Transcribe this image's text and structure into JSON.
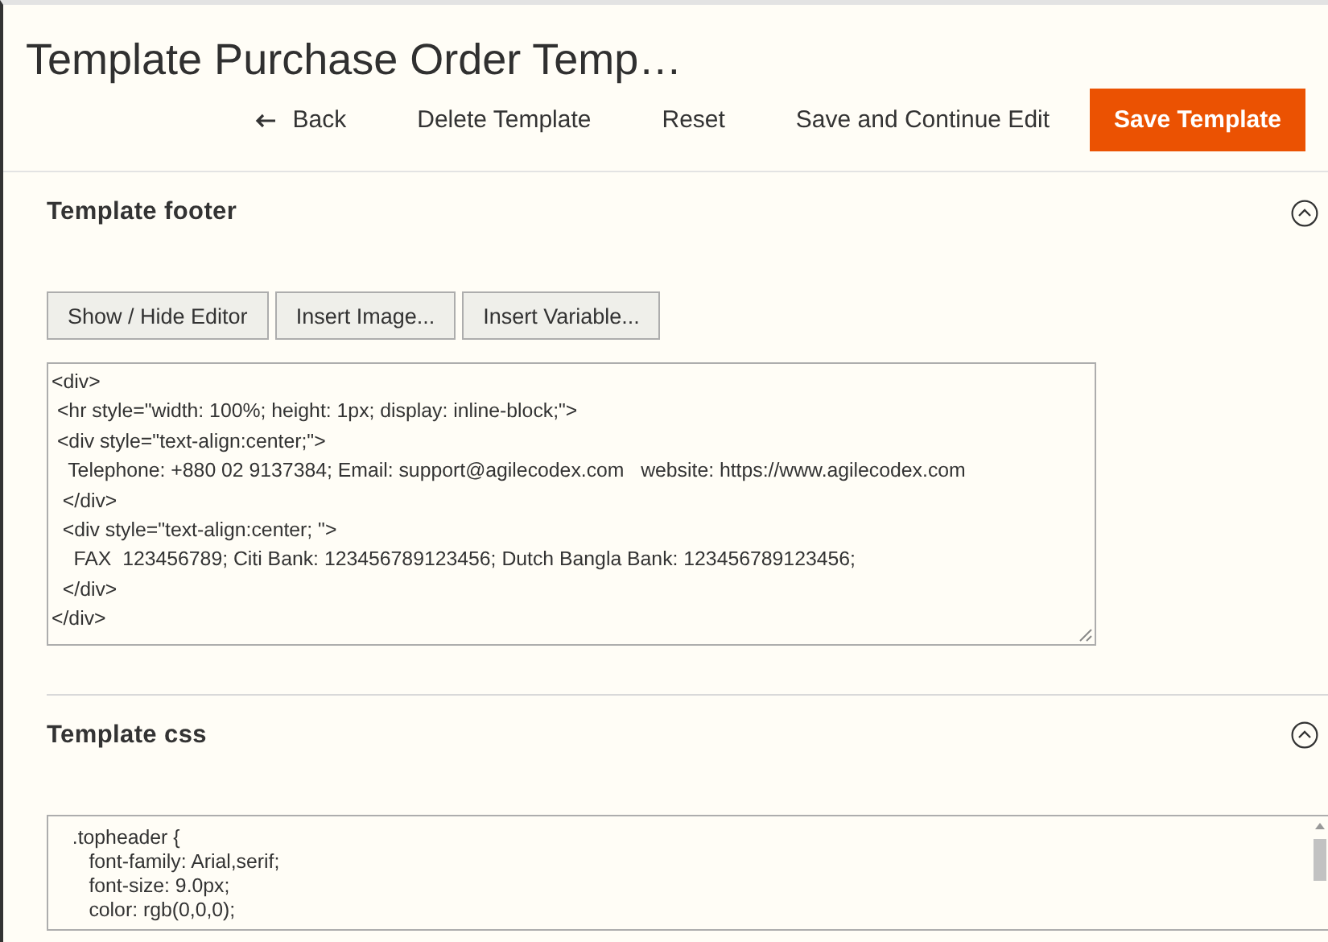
{
  "page": {
    "title": "Template Purchase Order Temp…"
  },
  "actions": [
    {
      "label": "Back",
      "kind": "back"
    },
    {
      "label": "Delete Template",
      "kind": "link"
    },
    {
      "label": "Reset",
      "kind": "link"
    },
    {
      "label": "Save and Continue Edit",
      "kind": "link"
    },
    {
      "label": "Save Template",
      "kind": "primary"
    }
  ],
  "sections": [
    {
      "title": "Template footer",
      "expanded": true,
      "toolbar": [
        "Show / Hide Editor",
        "Insert Image...",
        "Insert Variable..."
      ],
      "code_lines": [
        "<div>",
        " <hr style=\"width: 100%; height: 1px; display: inline-block;\">",
        " <div style=\"text-align:center;\">",
        "   Telephone: +880 02 9137384; Email: support@agilecodex.com   website: https://www.agilecodex.com",
        "  </div>",
        "  <div style=\"text-align:center; \">",
        "    FAX  123456789; Citi Bank: 123456789123456; Dutch Bangla Bank: 123456789123456;",
        "  </div>",
        "</div>"
      ]
    },
    {
      "title": "Template css",
      "expanded": true,
      "code_lines": [
        "  .topheader {",
        "     font-family: Arial,serif;",
        "     font-size: 9.0px;",
        "     color: rgb(0,0,0);"
      ]
    }
  ]
}
